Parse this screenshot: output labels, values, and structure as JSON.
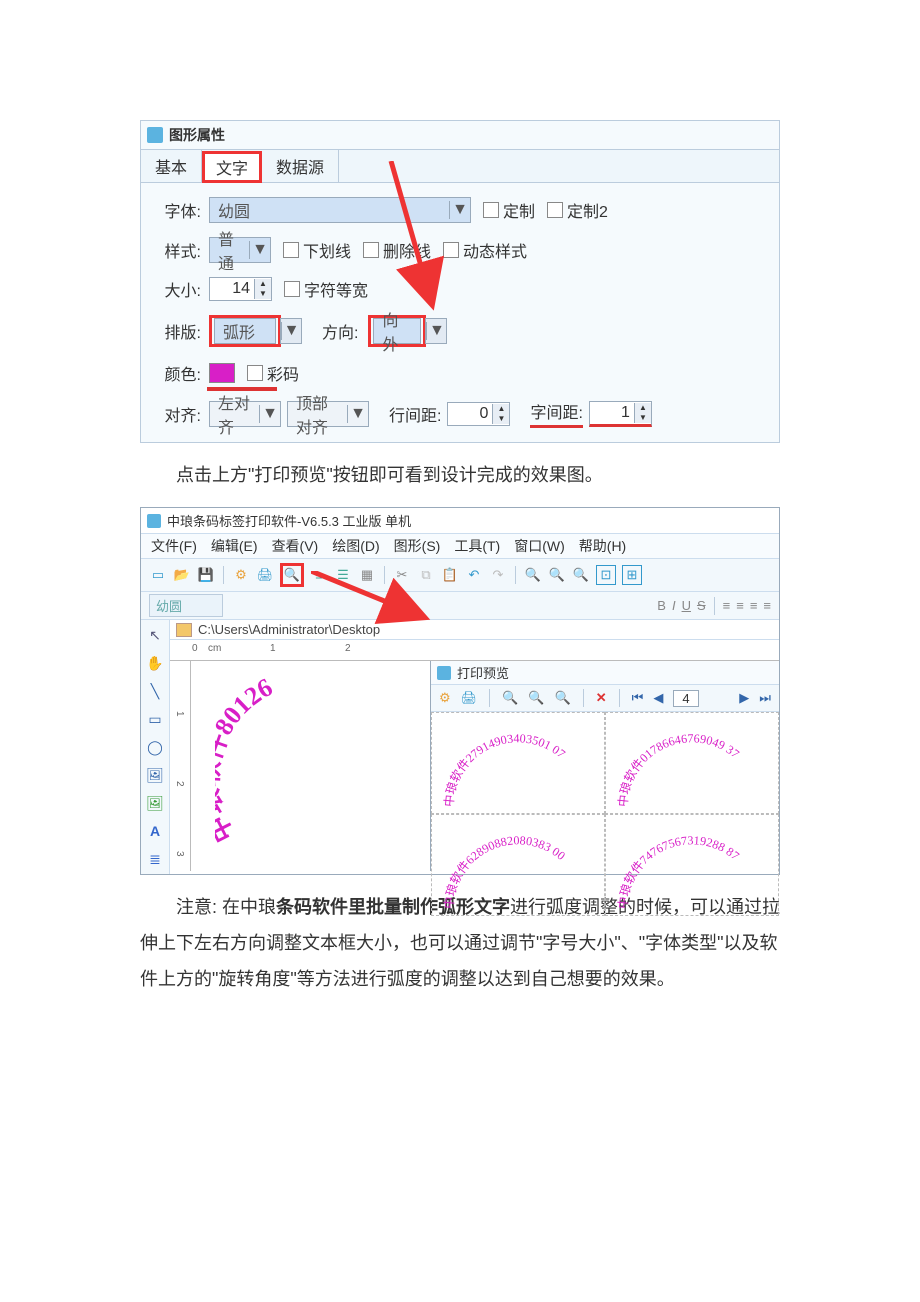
{
  "panel": {
    "title": "图形属性",
    "tabs": {
      "basic": "基本",
      "text": "文字",
      "data": "数据源"
    },
    "labels": {
      "font": "字体:",
      "style": "样式:",
      "size": "大小:",
      "layout": "排版:",
      "dir": "方向:",
      "color": "颜色:",
      "align": "对齐:",
      "linesp": "行间距:",
      "charsp": "字间距:"
    },
    "values": {
      "font": "幼圆",
      "style": "普通",
      "size": "14",
      "layout": "弧形",
      "dir": "向外",
      "halign": "左对齐",
      "valign": "顶部对齐",
      "linesp": "0",
      "charsp": "1"
    },
    "checks": {
      "custom1": "定制",
      "custom2": "定制2",
      "underline": "下划线",
      "strike": "删除线",
      "dynamic": "动态样式",
      "mono": "字符等宽",
      "colorcode": "彩码"
    }
  },
  "para1": "点击上方\"打印预览\"按钮即可看到设计完成的效果图。",
  "app": {
    "title": "中琅条码标签打印软件-V6.5.3 工业版 单机",
    "menu": {
      "file": "文件(F)",
      "edit": "编辑(E)",
      "view": "查看(V)",
      "draw": "绘图(D)",
      "shape": "图形(S)",
      "tool": "工具(T)",
      "window": "窗口(W)",
      "help": "帮助(H)"
    },
    "fontname": "幼圆",
    "path": "C:\\Users\\Administrator\\Desktop",
    "ruler": {
      "u": "cm",
      "t0": "0",
      "t1": "1",
      "t2": "2",
      "v1": "1",
      "v2": "2",
      "v3": "3"
    },
    "bigArc": "中琅软件80126",
    "preview": {
      "title": "打印预览",
      "page": "4",
      "arcs": [
        "中琅软件27914903403501 07",
        "中琅软件01786646769049 37",
        "中琅软件62890882080383 00",
        "中琅软件74767567319288 87"
      ]
    }
  },
  "para2": {
    "a": "注意: ",
    "b": "在中琅",
    "c": "条码软件里批量制作弧形文字",
    "d": "进行弧度调整的时候，可以通过拉伸上下左右方向调整文本框大小，也可以通过调节\"字号大小\"、\"字体类型\"以及软件上方的\"旋转角度\"等方法进行弧度的调整以达到自己想要的效果。"
  }
}
